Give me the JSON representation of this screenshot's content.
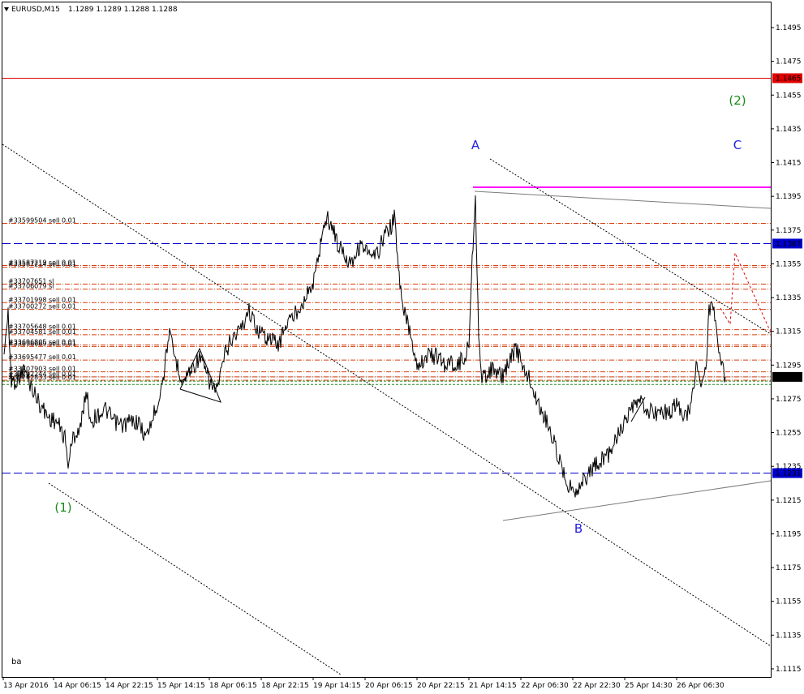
{
  "header": {
    "symbol_label": "EURUSD,M15",
    "ohlc": "1.1289 1.1289 1.1288 1.1288"
  },
  "watermark": "ba",
  "price_axis": {
    "min": 1.1105,
    "max": 1.1505,
    "ticks": [
      "1.1495",
      "1.1475",
      "1.1455",
      "1.1435",
      "1.1415",
      "1.1395",
      "1.1375",
      "1.1355",
      "1.1335",
      "1.1315",
      "1.1295",
      "1.1275",
      "1.1255",
      "1.1235",
      "1.1215",
      "1.1195",
      "1.1175",
      "1.1155",
      "1.1135",
      "1.1115"
    ]
  },
  "time_axis": {
    "labels": [
      "13 Apr 2016",
      "14 Apr 06:15",
      "14 Apr 22:15",
      "15 Apr 14:15",
      "18 Apr 06:15",
      "18 Apr 22:15",
      "19 Apr 14:15",
      "20 Apr 06:15",
      "20 Apr 22:15",
      "21 Apr 14:15",
      "22 Apr 06:30",
      "22 Apr 22:30",
      "25 Apr 14:30",
      "26 Apr 06:30"
    ]
  },
  "levels": [
    {
      "label": "1.1465",
      "price": 1.1465,
      "color": "#e00000",
      "style": "solid"
    },
    {
      "label": "1.1367",
      "price": 1.1367,
      "color": "#0000cc",
      "style": "dash"
    },
    {
      "label": "1.1231",
      "price": 1.1231,
      "color": "#0000cc",
      "style": "dash"
    },
    {
      "label": "1.1288",
      "price": 1.1288,
      "color": "#000000",
      "style": "bid"
    }
  ],
  "wave_labels": [
    {
      "text": "A",
      "color": "#2020e0"
    },
    {
      "text": "B",
      "color": "#2020e0"
    },
    {
      "text": "C",
      "color": "#2020e0"
    },
    {
      "text": "(1)",
      "color": "#1a8a1a"
    },
    {
      "text": "(2)",
      "color": "#1a8a1a"
    }
  ],
  "orders": [
    {
      "text": "#33599504 sell 0.01",
      "price": 1.1379
    },
    {
      "text": "#33587219 sell 0.01",
      "price": 1.1354
    },
    {
      "text": "#33587214 sell 0.01",
      "price": 1.1353
    },
    {
      "text": "#33707651 sl",
      "price": 1.1343
    },
    {
      "text": "#33706079 sl",
      "price": 1.134
    },
    {
      "text": "#33701998 sell 0.01",
      "price": 1.1332
    },
    {
      "text": "#33700272 sell 0.01",
      "price": 1.1328
    },
    {
      "text": "#33705648 sell 0.01",
      "price": 1.1316
    },
    {
      "text": "#33704581 sell 0.01",
      "price": 1.1313
    },
    {
      "text": "#33696805 sell 0.01",
      "price": 1.1307
    },
    {
      "text": "#33696669 sell 0.01",
      "price": 1.1306
    },
    {
      "text": "#33695477 sell 0.01",
      "price": 1.1298
    },
    {
      "text": "#33707903 sell 0.01",
      "price": 1.1291
    },
    {
      "text": "#33702244 sell 0.01",
      "price": 1.1288
    },
    {
      "text": "#33702833 sell 0.01",
      "price": 1.1286
    }
  ],
  "colors": {
    "resistance": "#ff00ff",
    "order_line": "#d84010",
    "green_line": "#1a8a1a"
  }
}
